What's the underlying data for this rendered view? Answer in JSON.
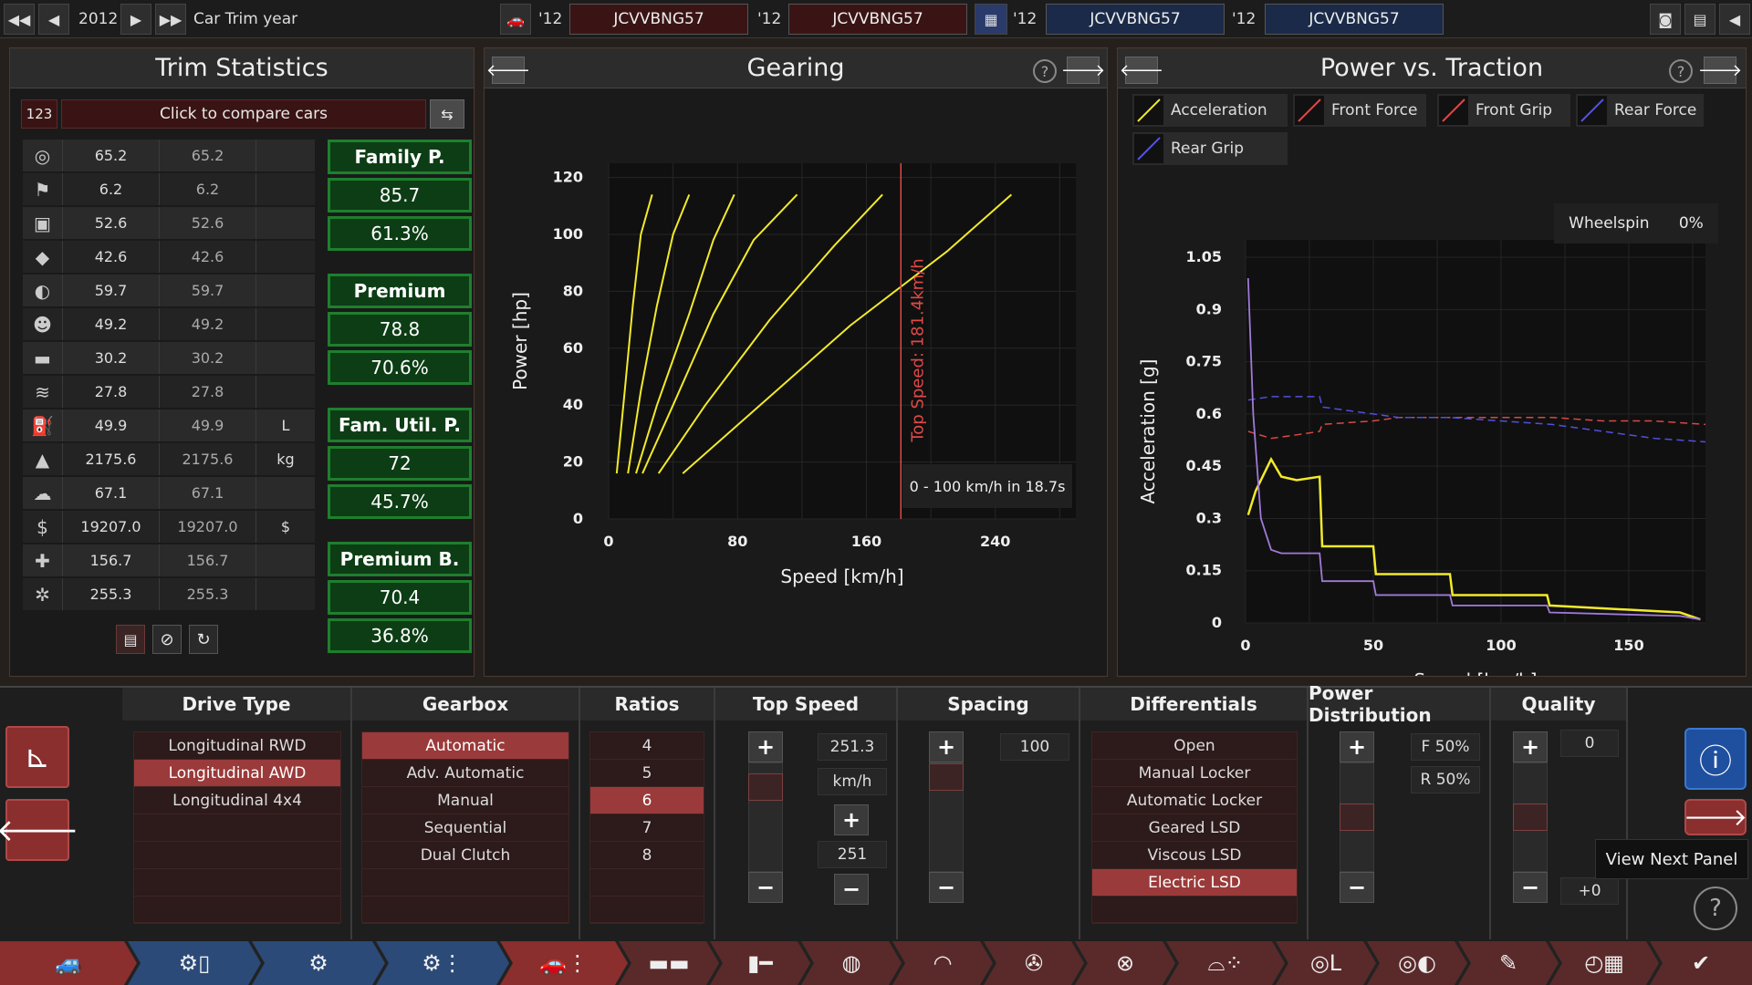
{
  "topbar": {
    "year": "2012",
    "label": "Car Trim year",
    "slots": [
      {
        "yr": "'12",
        "vin": "JCVVBNG57"
      },
      {
        "yr": "'12",
        "vin": "JCVVBNG57"
      },
      {
        "yr": "'12",
        "vin": "JCVVBNG57"
      },
      {
        "yr": "'12",
        "vin": "JCVVBNG57"
      }
    ]
  },
  "trim": {
    "title": "Trim Statistics",
    "compare_num": "123",
    "compare_label": "Click to compare cars",
    "rows": [
      {
        "icon": "steering-wheel-icon",
        "glyph": "◎",
        "a": "65.2",
        "b": "65.2",
        "u": ""
      },
      {
        "icon": "race-flag-icon",
        "glyph": "⚑",
        "a": "6.2",
        "b": "6.2",
        "u": ""
      },
      {
        "icon": "seat-icon",
        "glyph": "▣",
        "a": "52.6",
        "b": "52.6",
        "u": ""
      },
      {
        "icon": "diamond-icon",
        "glyph": "◆",
        "a": "42.6",
        "b": "42.6",
        "u": ""
      },
      {
        "icon": "safety-icon",
        "glyph": "◐",
        "a": "59.7",
        "b": "59.7",
        "u": ""
      },
      {
        "icon": "passengers-icon",
        "glyph": "☻",
        "a": "49.2",
        "b": "49.2",
        "u": ""
      },
      {
        "icon": "cargo-car-icon",
        "glyph": "▬",
        "a": "30.2",
        "b": "30.2",
        "u": ""
      },
      {
        "icon": "offroad-car-icon",
        "glyph": "≋",
        "a": "27.8",
        "b": "27.8",
        "u": ""
      },
      {
        "icon": "fuel-icon",
        "glyph": "⛽",
        "a": "49.9",
        "b": "49.9",
        "u": "L"
      },
      {
        "icon": "weight-icon",
        "glyph": "▲",
        "a": "2175.6",
        "b": "2175.6",
        "u": "kg"
      },
      {
        "icon": "emissions-icon",
        "glyph": "☁",
        "a": "67.1",
        "b": "67.1",
        "u": ""
      },
      {
        "icon": "money-bag-icon",
        "glyph": "$",
        "a": "19207.0",
        "b": "19207.0",
        "u": "$"
      },
      {
        "icon": "service-icon",
        "glyph": "✚",
        "a": "156.7",
        "b": "156.7",
        "u": ""
      },
      {
        "icon": "production-icon",
        "glyph": "✲",
        "a": "255.3",
        "b": "255.3",
        "u": ""
      }
    ],
    "groups": [
      {
        "name": "Family P.",
        "v1": "85.7",
        "v2": "61.3%"
      },
      {
        "name": "Premium",
        "v1": "78.8",
        "v2": "70.6%"
      },
      {
        "name": "Fam. Util. P.",
        "v1": "72",
        "v2": "45.7%"
      },
      {
        "name": "Premium B.",
        "v1": "70.4",
        "v2": "36.8%"
      }
    ]
  },
  "gearing": {
    "title": "Gearing",
    "box_text": "0 - 100 km/h in 18.7s"
  },
  "power": {
    "title": "Power vs. Traction",
    "wheelspin_label": "Wheelspin",
    "wheelspin_value": "0%",
    "legend": [
      {
        "name": "Acceleration",
        "color": "#f2ea2a"
      },
      {
        "name": "Front Force",
        "color": "#e04848"
      },
      {
        "name": "Front Grip",
        "color": "#e04848"
      },
      {
        "name": "Rear Force",
        "color": "#5252e8"
      },
      {
        "name": "Rear Grip",
        "color": "#5252e8"
      }
    ]
  },
  "chart_data": [
    {
      "type": "line",
      "title": "Gearing",
      "xlabel": "Speed [km/h]",
      "ylabel": "Power [hp]",
      "xlim": [
        0,
        290
      ],
      "ylim": [
        0,
        125
      ],
      "xticks": [
        "0",
        "80",
        "160",
        "240"
      ],
      "yticks": [
        "0",
        "20",
        "40",
        "60",
        "80",
        "100",
        "120"
      ],
      "annotation": "Top Speed: 181.4km/h",
      "top_speed": 181.4,
      "series": [
        {
          "x": [
            5,
            10,
            15,
            20,
            27
          ],
          "y": [
            16,
            45,
            75,
            100,
            114
          ]
        },
        {
          "x": [
            12,
            20,
            30,
            40,
            50
          ],
          "y": [
            16,
            45,
            75,
            100,
            114
          ]
        },
        {
          "x": [
            17,
            30,
            50,
            65,
            78
          ],
          "y": [
            16,
            40,
            72,
            98,
            114
          ]
        },
        {
          "x": [
            21,
            40,
            65,
            90,
            117
          ],
          "y": [
            16,
            40,
            72,
            98,
            114
          ]
        },
        {
          "x": [
            31,
            60,
            100,
            140,
            170
          ],
          "y": [
            16,
            40,
            70,
            96,
            114
          ]
        },
        {
          "x": [
            46,
            90,
            150,
            210,
            250
          ],
          "y": [
            16,
            38,
            68,
            94,
            114
          ]
        }
      ]
    },
    {
      "type": "line",
      "title": "Power vs. Traction",
      "xlabel": "Speed [km/h]",
      "ylabel": "Acceleration [g]",
      "xlim": [
        0,
        180
      ],
      "ylim": [
        0,
        1.1
      ],
      "xticks": [
        "0",
        "50",
        "100",
        "150"
      ],
      "yticks": [
        "0",
        "0.15",
        "0.3",
        "0.45",
        "0.6",
        "0.75",
        "0.9",
        "1.05"
      ],
      "series": [
        {
          "name": "Acceleration",
          "x": [
            1,
            4,
            10,
            14,
            20,
            29,
            30,
            50,
            51,
            80,
            81,
            118,
            119,
            170,
            178
          ],
          "y": [
            0.31,
            0.38,
            0.47,
            0.42,
            0.41,
            0.42,
            0.22,
            0.22,
            0.14,
            0.14,
            0.08,
            0.08,
            0.05,
            0.03,
            0.01
          ]
        },
        {
          "name": "Front Force",
          "x": [
            1,
            10,
            20,
            29,
            30,
            50,
            60,
            80,
            100,
            120,
            140,
            160,
            180
          ],
          "y": [
            0.55,
            0.53,
            0.54,
            0.55,
            0.57,
            0.58,
            0.59,
            0.59,
            0.59,
            0.59,
            0.58,
            0.58,
            0.57
          ]
        },
        {
          "name": "Rear Force",
          "x": [
            1,
            10,
            20,
            29,
            30,
            50,
            60,
            80,
            100,
            120,
            140,
            160,
            180
          ],
          "y": [
            0.64,
            0.65,
            0.65,
            0.65,
            0.62,
            0.6,
            0.59,
            0.59,
            0.58,
            0.57,
            0.55,
            0.53,
            0.52
          ]
        },
        {
          "name": "Rear Grip",
          "x": [
            1,
            3,
            6,
            10,
            14,
            20,
            29,
            30,
            50,
            51,
            80,
            81,
            118,
            119,
            170,
            178
          ],
          "y": [
            0.99,
            0.6,
            0.3,
            0.21,
            0.2,
            0.2,
            0.2,
            0.12,
            0.12,
            0.08,
            0.08,
            0.05,
            0.05,
            0.03,
            0.02,
            0.01
          ]
        }
      ]
    }
  ],
  "bottom": {
    "drive": {
      "title": "Drive Type",
      "items": [
        "Longitudinal RWD",
        "Longitudinal AWD",
        "Longitudinal 4x4"
      ],
      "selected": 1
    },
    "gearbox": {
      "title": "Gearbox",
      "items": [
        "Automatic",
        "Adv. Automatic",
        "Manual",
        "Sequential",
        "Dual Clutch"
      ],
      "selected": 0
    },
    "ratios": {
      "title": "Ratios",
      "items": [
        "4",
        "5",
        "6",
        "7",
        "8"
      ],
      "selected": 2
    },
    "topspeed": {
      "title": "Top Speed",
      "value": "251.3",
      "unit": "km/h",
      "target": "251",
      "level": 0.88
    },
    "spacing": {
      "title": "Spacing",
      "value": "100",
      "level": 1.0
    },
    "diff": {
      "title": "Differentials",
      "items": [
        "Open",
        "Manual Locker",
        "Automatic Locker",
        "Geared LSD",
        "Viscous LSD",
        "Electric LSD"
      ],
      "selected": 5
    },
    "powerdist": {
      "title": "Power Distribution",
      "front": "F 50%",
      "rear": "R 50%",
      "level": 0.5
    },
    "quality": {
      "title": "Quality",
      "value": "0",
      "mod": "+0",
      "level": 0.5
    },
    "tooltip": "View Next Panel"
  }
}
